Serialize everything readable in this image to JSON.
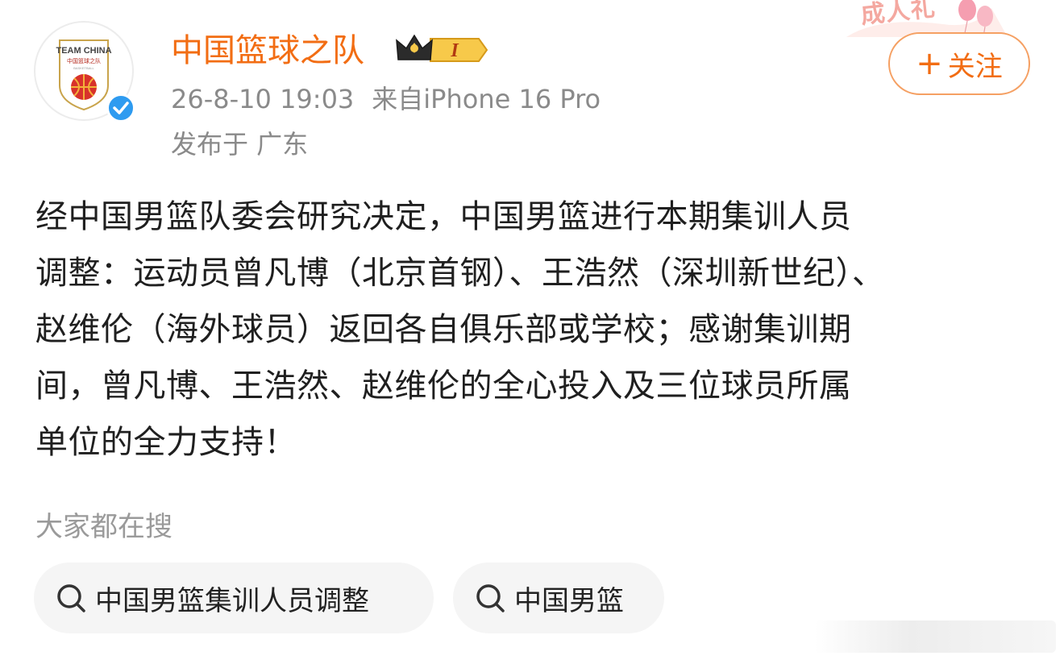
{
  "header": {
    "avatar": {
      "logo_line1": "TEAM CHINA",
      "logo_line2": "中国篮球之队",
      "logo_line3": "BASKETBALL"
    },
    "username": "中国篮球之队",
    "vip_level": "I",
    "timestamp": "26-8-10 19:03",
    "source": "来自iPhone 16 Pro",
    "location": "发布于 广东",
    "follow_label": "关注",
    "decoration_text": "成人礼"
  },
  "post": {
    "lines": [
      "经中国男篮队委会研究决定，中国男篮进行本期集训人员",
      "调整：运动员曾凡博（北京首钢）、王浩然（深圳新世纪）、",
      "赵维伦（海外球员）返回各自俱乐部或学校；感谢集训期",
      "间，曾凡博、王浩然、赵维伦的全心投入及三位球员所属",
      "单位的全力支持！"
    ]
  },
  "trending": {
    "label": "大家都在搜",
    "chips": [
      "中国男篮集训人员调整",
      "中国男篮"
    ]
  },
  "colors": {
    "brand_orange": "#f26d13",
    "follow_border": "#f5a063",
    "meta_gray": "#8a8a8a",
    "verified_blue": "#2e9bf0",
    "chip_bg": "#f5f5f5"
  },
  "icons": {
    "verified": "verified-check-icon",
    "vip": "crown-vip-icon",
    "search": "search-icon",
    "follow_plus": "plus-icon"
  }
}
